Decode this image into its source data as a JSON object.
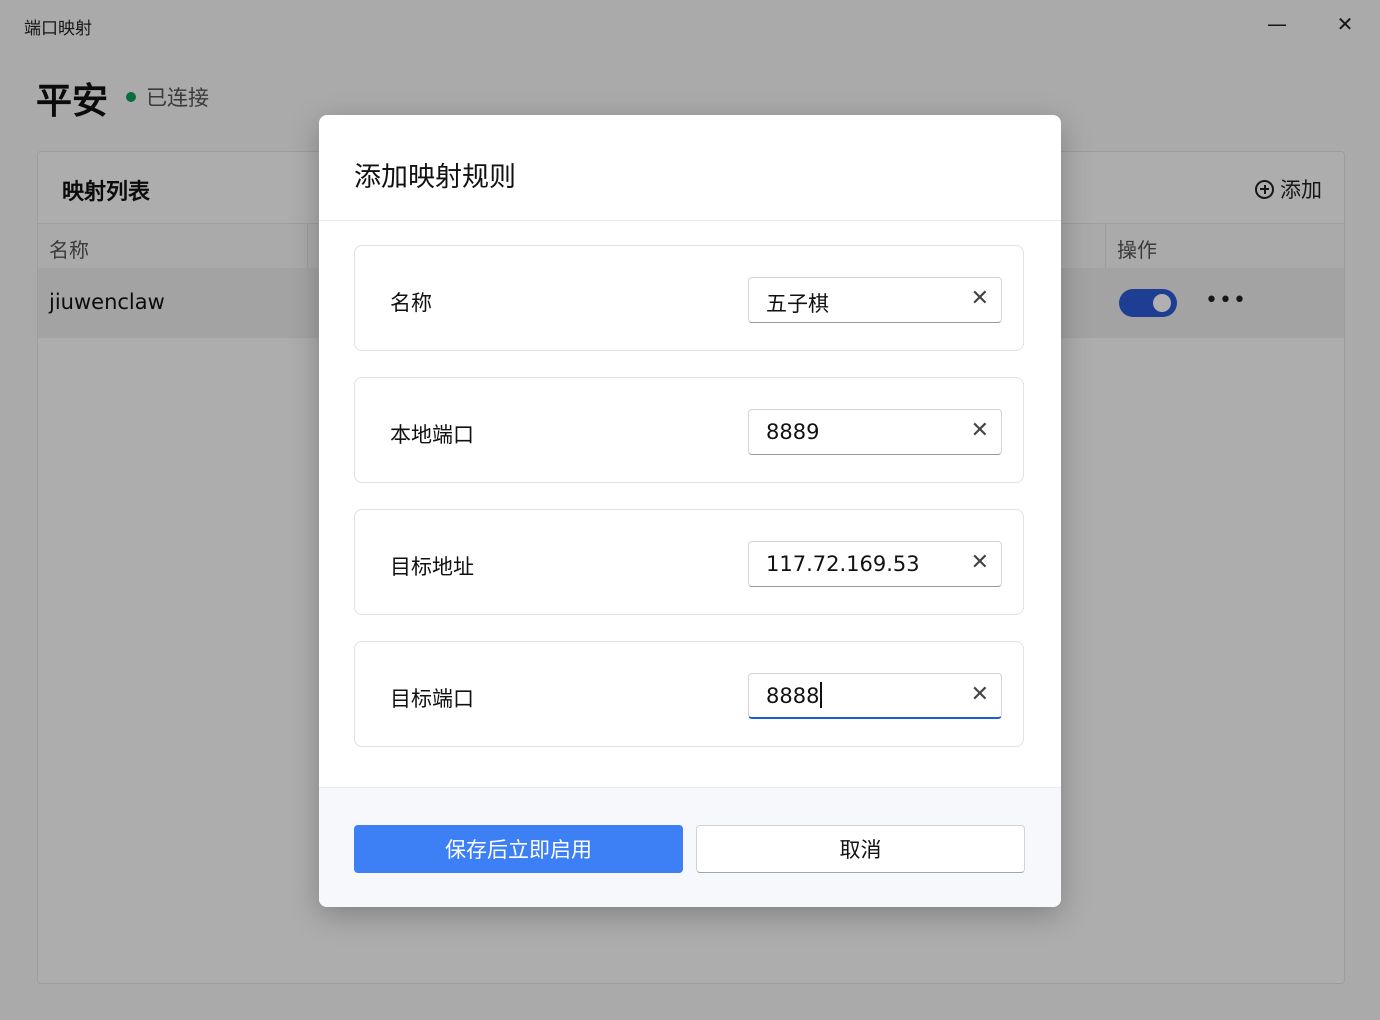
{
  "window": {
    "title": "端口映射"
  },
  "connection": {
    "name": "平安",
    "status": "已连接",
    "status_color": "#0f9d58"
  },
  "panel": {
    "title": "映射列表",
    "add_label": "添加",
    "columns": {
      "name": "名称",
      "actions": "操作"
    },
    "rows": [
      {
        "name": "jiuwenclaw",
        "enabled": true
      }
    ]
  },
  "dialog": {
    "title": "添加映射规则",
    "fields": [
      {
        "label": "名称",
        "value": "五子棋"
      },
      {
        "label": "本地端口",
        "value": "8889"
      },
      {
        "label": "目标地址",
        "value": "117.72.169.53"
      },
      {
        "label": "目标端口",
        "value": "8888",
        "focused": true
      }
    ],
    "save_label": "保存后立即启用",
    "cancel_label": "取消"
  },
  "colors": {
    "accent": "#3d7ff5",
    "toggle": "#2c5bd7"
  }
}
